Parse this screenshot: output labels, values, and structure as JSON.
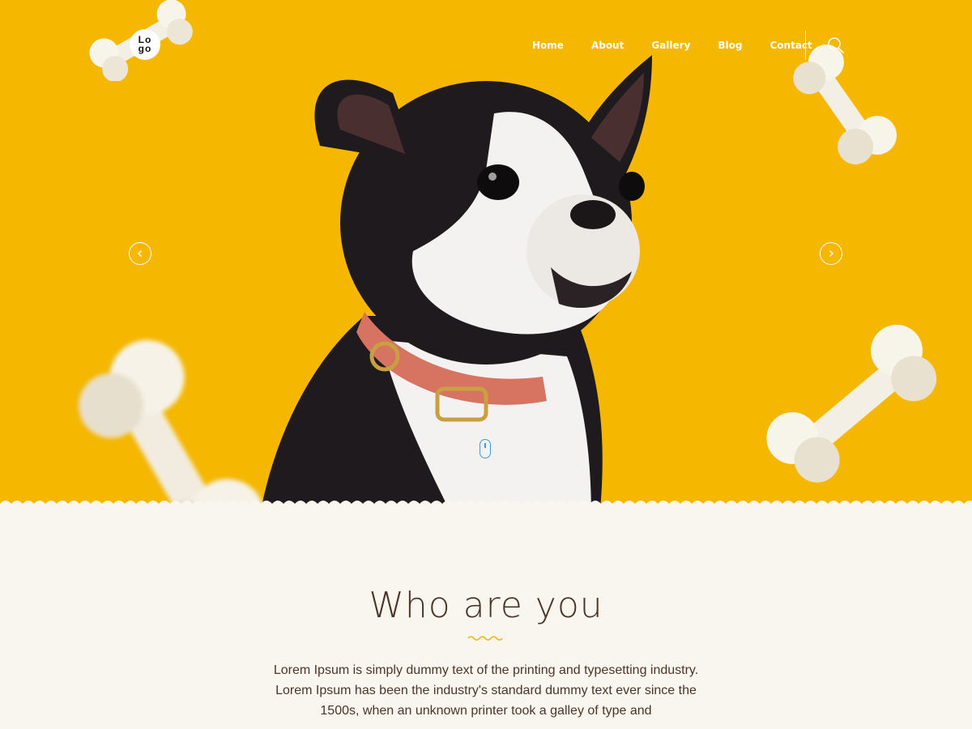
{
  "brand": {
    "logo_line1": "Lo",
    "logo_line2": "go"
  },
  "nav": {
    "items": [
      {
        "label": "Home"
      },
      {
        "label": "About"
      },
      {
        "label": "Gallery"
      },
      {
        "label": "Blog"
      },
      {
        "label": "Contact"
      }
    ]
  },
  "icons": {
    "search": "search-icon",
    "prev": "chevron-left-icon",
    "next": "chevron-right-icon",
    "scroll": "mouse-scroll-icon"
  },
  "colors": {
    "hero_bg": "#f5b700",
    "content_bg": "#f9f6f0",
    "text": "#4a3628",
    "accent": "#f5b700"
  },
  "section": {
    "title": "Who are you",
    "paragraph": "Lorem Ipsum is simply dummy text of the printing and typesetting industry. Lorem Ipsum has been the industry's standard dummy text ever since the 1500s, when an unknown printer took a galley of type and"
  }
}
